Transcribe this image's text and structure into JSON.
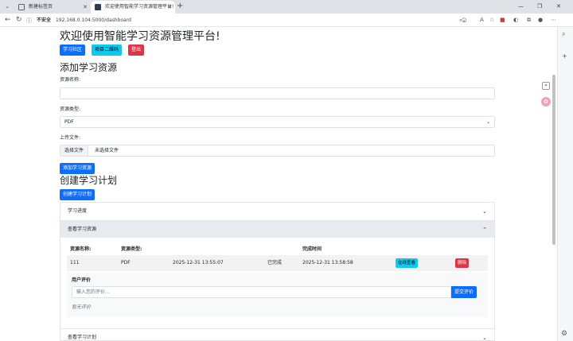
{
  "browser": {
    "tabs": [
      {
        "title": "新建标签页"
      },
      {
        "title": "欢迎使用智能学习资源管理平台!"
      }
    ],
    "address": {
      "security": "不安全",
      "url": "192.168.0.104:5000/dashboard"
    },
    "zoom_label": "A"
  },
  "page": {
    "title": "欢迎使用智能学习资源管理平台!",
    "nav_buttons": {
      "community": "学习社区",
      "qrcode": "项目二维码",
      "logout": "登出"
    },
    "add_section": {
      "heading": "添加学习资源",
      "name_label": "资源名称:",
      "name_value": "",
      "type_label": "资源类型:",
      "type_value": "PDF",
      "upload_label": "上传文件:",
      "file_button": "选择文件",
      "file_name": "未选择文件",
      "submit": "添加学习资源"
    },
    "plan_section": {
      "heading": "创建学习计划",
      "create_button": "创建学习计划"
    },
    "accordion": {
      "progress": "学习进度",
      "resources": "查看学习资源",
      "plans": "查看学习计划"
    },
    "table": {
      "headers": {
        "name": "资源名称:",
        "type": "资源类型:",
        "done_time": "完成时间"
      },
      "row": {
        "name": "111",
        "type": "PDF",
        "created": "2025-12-31 13:55:07",
        "status": "已完成",
        "finished": "2025-12-31 13:58:58",
        "view": "在线查看",
        "delete": "删除"
      }
    },
    "evaluation": {
      "title": "用户评价",
      "placeholder": "输入您的评价...",
      "submit": "提交评价",
      "empty": "暂无评价"
    }
  }
}
